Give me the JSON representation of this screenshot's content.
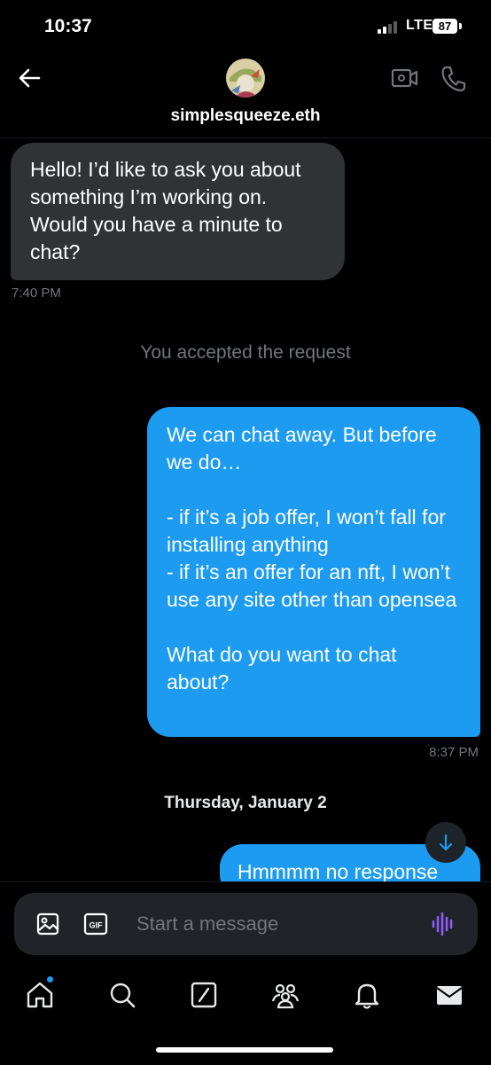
{
  "status_bar": {
    "time": "10:37",
    "network": "LTE",
    "battery": "87"
  },
  "header": {
    "contact_name": "simplesqueeze.eth",
    "back_icon": "arrow-left-icon",
    "video_icon": "video-call-icon",
    "call_icon": "phone-icon"
  },
  "messages": [
    {
      "direction": "incoming",
      "text": "Hello! I’d like to ask you about something I’m working on. Would you have a minute to chat?",
      "time": "7:40 PM"
    },
    {
      "type": "system",
      "text": "You accepted the request"
    },
    {
      "direction": "outgoing",
      "text": "We can chat away. But before we do…\n\n- if it’s a job offer, I won’t fall for installing anything\n- if it’s an offer for an nft, I won’t use any site other than opensea\n\nWhat do you want to chat about?",
      "time": "8:37 PM"
    },
    {
      "type": "date",
      "text": "Thursday, January 2"
    },
    {
      "direction": "outgoing",
      "text": "Hmmmm no response"
    }
  ],
  "composer": {
    "placeholder": "Start a message",
    "gif_label": "GIF"
  },
  "tab_bar": [
    {
      "name": "home",
      "icon": "home-icon",
      "active": true
    },
    {
      "name": "search",
      "icon": "search-icon"
    },
    {
      "name": "grok",
      "icon": "grok-icon"
    },
    {
      "name": "communities",
      "icon": "communities-icon"
    },
    {
      "name": "notifications",
      "icon": "bell-icon"
    },
    {
      "name": "messages",
      "icon": "mail-icon"
    }
  ],
  "colors": {
    "accent": "#1d9bf0",
    "incoming_bubble": "#2f3336",
    "muted_text": "#71767b",
    "voice_icon": "#8b5cf6"
  }
}
